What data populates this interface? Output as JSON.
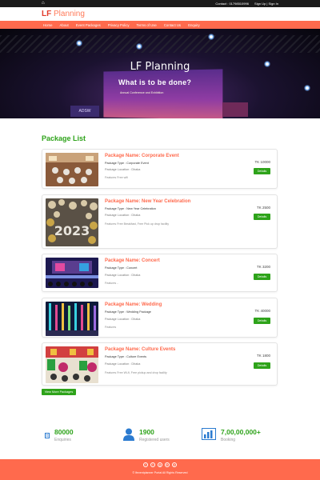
{
  "topbar": {
    "contact": "Contact : 01798510996",
    "signup": "Sign Up | Sign In"
  },
  "brand": {
    "name_part1": "LF ",
    "name_part2": "Planning"
  },
  "nav": [
    "Home",
    "About",
    "Event Packages",
    "Privacy Policy",
    "Terms of Use",
    "Contact Us",
    "Enquiry"
  ],
  "hero": {
    "title": "LF Planning",
    "screen_text": "What is to be done?",
    "screen_sub": "Annual Conference and Exhibition",
    "sign_text": "ADSW"
  },
  "section_title": "Package List",
  "labels": {
    "location": "Package Location : ",
    "features": "Features ",
    "details": "Details"
  },
  "packages": [
    {
      "name": "Package Name: Corporate Event",
      "type": "Package Type : Corporate Event",
      "location": "Dhaka",
      "features": "Free wifi",
      "price": "TK 10000"
    },
    {
      "name": "Package Name: New Year Celebration",
      "type": "Package Type : New Year Celebration",
      "location": "Dhaka",
      "features": "Free Breakfast, Free Pick up drop facility",
      "price": "TK 2500"
    },
    {
      "name": "Package Name: Concert",
      "type": "Package Type : Concert",
      "location": "Dhaka",
      "features": "..",
      "price": "TK 3200"
    },
    {
      "name": "Package Name: Wedding",
      "type": "Package Type : Wedding Package",
      "location": "Dhaka",
      "features": "",
      "price": "TK 40000"
    },
    {
      "name": "Package Name: Culture Events",
      "type": "Package Type : Culture Events",
      "location": "Dhaka",
      "features": "Free Wi-fi, Free pickup and drop facility",
      "price": "TK 1800"
    }
  ],
  "view_more": "View More Packages",
  "stats": [
    {
      "value": "80000",
      "label": "Enquiries",
      "icon": "enquiry-icon"
    },
    {
      "value": "1900",
      "label": "Registered users",
      "icon": "user-icon"
    },
    {
      "value": "7,00,00,000+",
      "label": "Booking",
      "icon": "chart-icon"
    }
  ],
  "footer": {
    "copyright": "© lfeventplanner Portal All Rights Reserved",
    "socials": [
      "f",
      "t",
      "g",
      "in",
      "p"
    ]
  },
  "colors": {
    "accent": "#ff6a4d",
    "green": "#2ea31a",
    "dark": "#1a1a1a"
  }
}
